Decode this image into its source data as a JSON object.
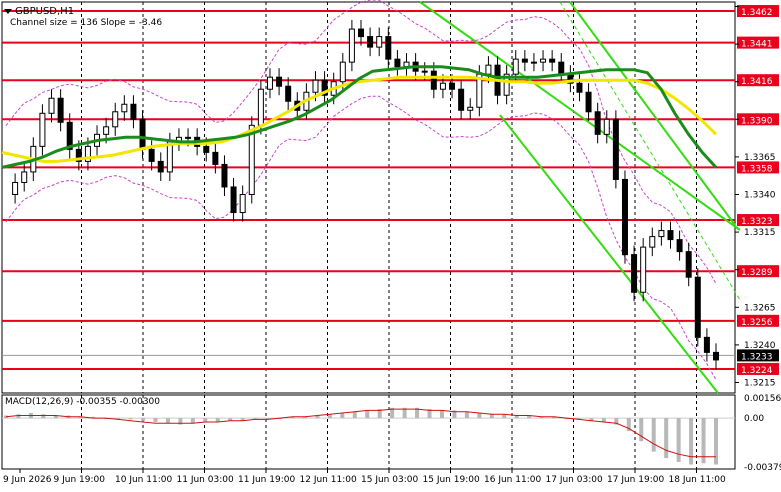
{
  "symbol": "GBPUSD,H1",
  "indicator_text": "Channel size = 136 Slope = -3.46",
  "macd_label": "MACD(12,26,9) -0.00355 -0.00300",
  "colors": {
    "level_line": "#e8001c",
    "bull_candle": "#000000",
    "ma_fast": "#1a8c1a",
    "ma_slow": "#f2e600",
    "channel": "#33dd11",
    "bollinger": "#cc44cc",
    "macd_hist": "#b8b8b8",
    "macd_signal": "#d01010"
  },
  "chart_data": {
    "type": "line",
    "title": "GBPUSD,H1",
    "price_axis": {
      "ticks": [
        "1.3465",
        "1.3440",
        "1.3415",
        "1.3390",
        "1.3365",
        "1.3340",
        "1.3315",
        "1.3290",
        "1.3265",
        "1.3240",
        "1.3215"
      ],
      "ylim": [
        1.3208,
        1.3468
      ]
    },
    "levels": [
      {
        "label": "1.3462",
        "value": 1.3462
      },
      {
        "label": "1.3441",
        "value": 1.3441
      },
      {
        "label": "1.3416",
        "value": 1.3416
      },
      {
        "label": "1.3390",
        "value": 1.339
      },
      {
        "label": "1.3358",
        "value": 1.3358
      },
      {
        "label": "1.3323",
        "value": 1.3323
      },
      {
        "label": "1.3289",
        "value": 1.3289
      },
      {
        "label": "1.3256",
        "value": 1.3256
      },
      {
        "label": "1.3224",
        "value": 1.3224
      }
    ],
    "current_price": {
      "label": "1.3233",
      "value": 1.3233
    },
    "time_labels": [
      "9 Jun 2026",
      "9 Jun 19:00",
      "10 Jun 11:00",
      "11 Jun 03:00",
      "11 Jun 19:00",
      "12 Jun 11:00",
      "15 Jun 03:00",
      "15 Jun 19:00",
      "16 Jun 11:00",
      "17 Jun 03:00",
      "17 Jun 19:00",
      "18 Jun 11:00"
    ],
    "price_path": [
      1.334,
      1.3348,
      1.3355,
      1.3372,
      1.3394,
      1.3404,
      1.3388,
      1.337,
      1.3362,
      1.3372,
      1.338,
      1.3385,
      1.3395,
      1.34,
      1.339,
      1.337,
      1.3362,
      1.3355,
      1.3375,
      1.3378,
      1.3378,
      1.3372,
      1.3368,
      1.336,
      1.3345,
      1.3328,
      1.334,
      1.3386,
      1.341,
      1.3418,
      1.3412,
      1.3402,
      1.3396,
      1.3408,
      1.3416,
      1.3406,
      1.3415,
      1.3428,
      1.345,
      1.3445,
      1.3438,
      1.3445,
      1.343,
      1.3425,
      1.3428,
      1.3422,
      1.3422,
      1.341,
      1.3414,
      1.341,
      1.3396,
      1.3398,
      1.342,
      1.3426,
      1.3406,
      1.342,
      1.343,
      1.3428,
      1.3428,
      1.343,
      1.3428,
      1.342,
      1.3414,
      1.3408,
      1.3395,
      1.338,
      1.339,
      1.335,
      1.33,
      1.3275,
      1.3305,
      1.3312,
      1.3316,
      1.331,
      1.3302,
      1.3285,
      1.3245,
      1.3235,
      1.323
    ],
    "ma_fast": [
      1.3358,
      1.336,
      1.3362,
      1.3365,
      1.3369,
      1.3372,
      1.3374,
      1.3376,
      1.3377,
      1.3378,
      1.3378,
      1.3377,
      1.3376,
      1.3375,
      1.3375,
      1.3376,
      1.3377,
      1.3378,
      1.338,
      1.3383,
      1.3386,
      1.3389,
      1.3393,
      1.3398,
      1.3403,
      1.341,
      1.3417,
      1.3422,
      1.3423,
      1.3424,
      1.3425,
      1.3425,
      1.3425,
      1.3424,
      1.3423,
      1.342,
      1.3418,
      1.3418,
      1.3418,
      1.3418,
      1.3419,
      1.342,
      1.3421,
      1.3422,
      1.3423,
      1.3423,
      1.3423,
      1.3421,
      1.341,
      1.3394,
      1.338,
      1.3368,
      1.3358
    ],
    "ma_slow": [
      1.3368,
      1.3366,
      1.3364,
      1.3362,
      1.3362,
      1.3363,
      1.3364,
      1.3365,
      1.3366,
      1.3368,
      1.337,
      1.3372,
      1.3373,
      1.3374,
      1.3374,
      1.3374,
      1.3375,
      1.3378,
      1.3382,
      1.3386,
      1.3391,
      1.3396,
      1.3402,
      1.3406,
      1.341,
      1.3413,
      1.3415,
      1.3416,
      1.3417,
      1.3418,
      1.3418,
      1.3418,
      1.3418,
      1.3418,
      1.3418,
      1.3417,
      1.3416,
      1.3415,
      1.3415,
      1.3414,
      1.3414,
      1.3415,
      1.3416,
      1.3416,
      1.3416,
      1.3416,
      1.3416,
      1.3414,
      1.341,
      1.3404,
      1.3397,
      1.3389,
      1.338
    ],
    "macd_axis": {
      "ticks": [
        "0.00156",
        "0.00",
        "-0.00379"
      ]
    },
    "macd_hist": [
      0.0002,
      0.0003,
      0.0004,
      0.0003,
      0.0002,
      0.0002,
      0.0001,
      0.0001,
      0.0,
      -0.0001,
      -0.0001,
      -0.0002,
      -0.0003,
      -0.0004,
      -0.0005,
      -0.0004,
      -0.0003,
      -0.0003,
      -0.0002,
      -0.0002,
      -0.0001,
      -0.0001,
      0.0,
      0.0001,
      0.0001,
      0.0002,
      0.0003,
      0.0004,
      0.0005,
      0.0006,
      0.0007,
      0.0008,
      0.0008,
      0.0008,
      0.0007,
      0.0006,
      0.0006,
      0.0005,
      0.0004,
      0.0003,
      0.0003,
      0.0002,
      0.0002,
      0.0001,
      0.0001,
      0.0,
      -0.0001,
      -0.0002,
      -0.0003,
      -0.0005,
      -0.001,
      -0.0018,
      -0.0026,
      -0.0031,
      -0.0034,
      -0.0036,
      -0.0035,
      -0.0036
    ],
    "macd_signal": [
      0.0001,
      0.0002,
      0.0002,
      0.0002,
      0.0002,
      0.0001,
      0.0001,
      0.0,
      0.0,
      -0.0001,
      -0.0002,
      -0.0003,
      -0.0004,
      -0.0004,
      -0.0004,
      -0.0004,
      -0.0003,
      -0.0003,
      -0.0002,
      -0.0002,
      -0.0001,
      -0.0001,
      0.0,
      0.0001,
      0.0001,
      0.0002,
      0.0003,
      0.0004,
      0.0005,
      0.0006,
      0.0006,
      0.0007,
      0.0007,
      0.0007,
      0.0006,
      0.0006,
      0.0005,
      0.0005,
      0.0004,
      0.0003,
      0.0003,
      0.0002,
      0.0002,
      0.0001,
      0.0001,
      0.0,
      -0.0001,
      -0.0002,
      -0.0003,
      -0.0004,
      -0.0008,
      -0.0014,
      -0.002,
      -0.0025,
      -0.0028,
      -0.003,
      -0.003,
      -0.003
    ]
  }
}
